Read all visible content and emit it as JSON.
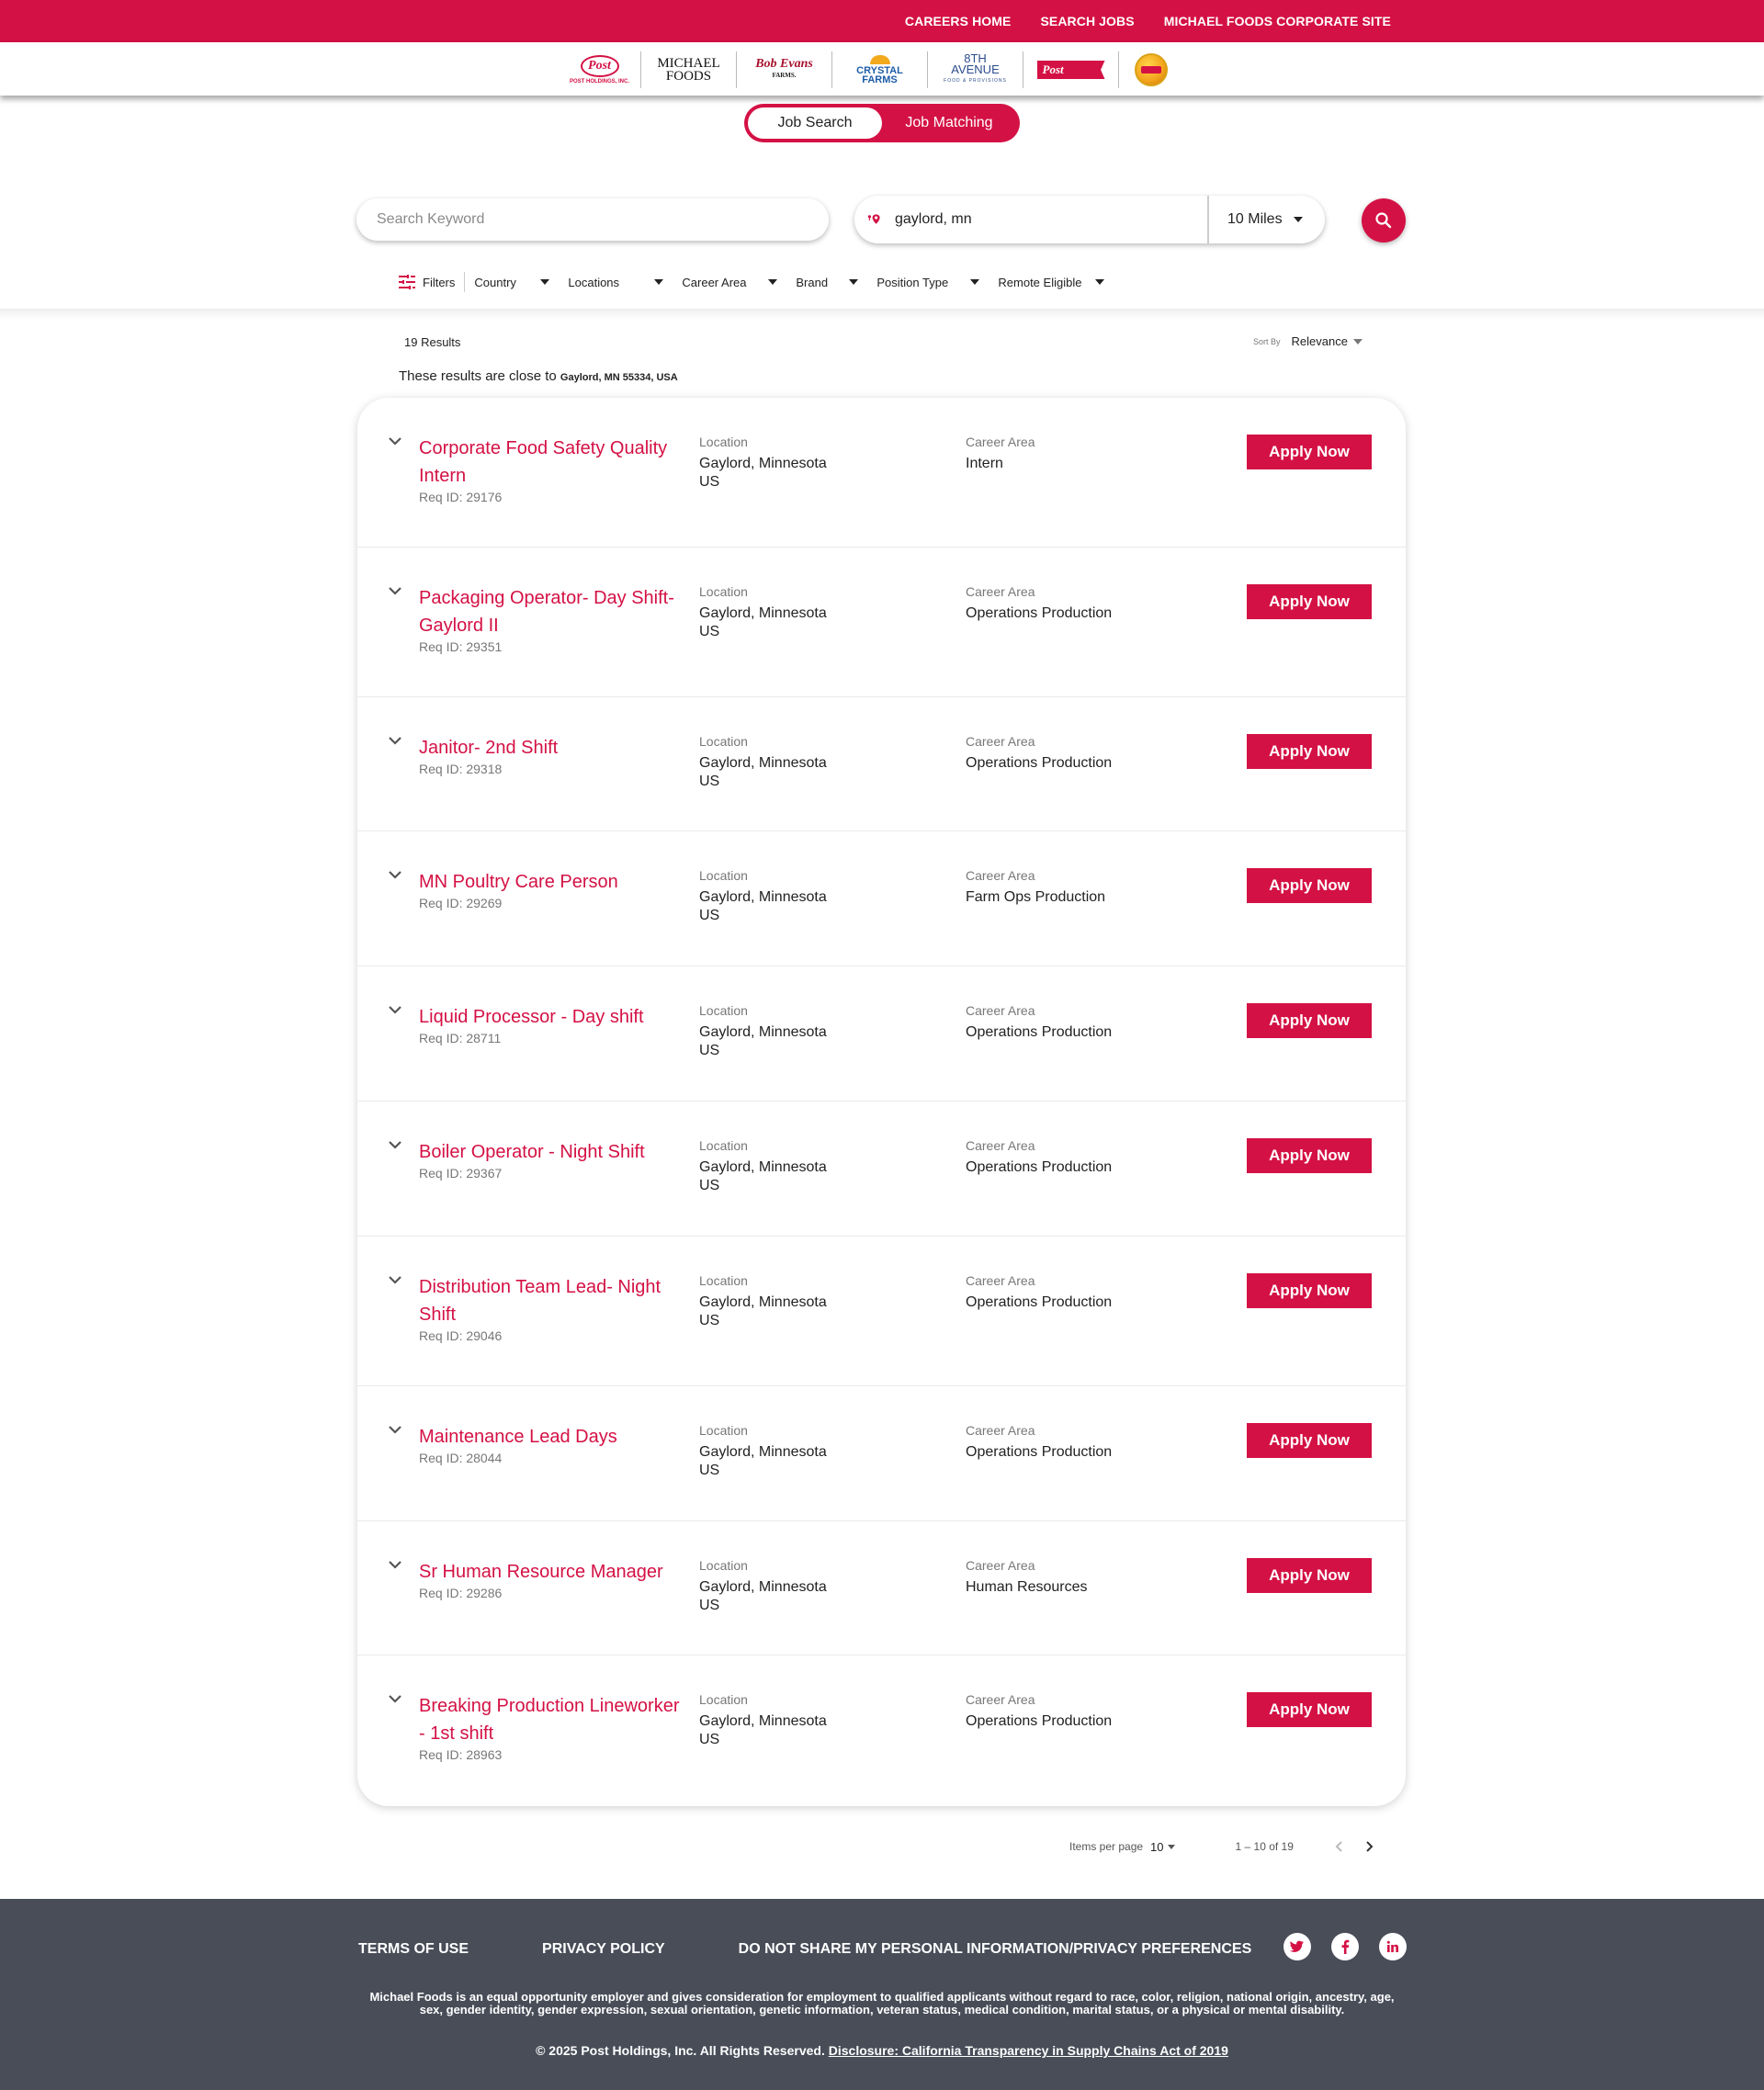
{
  "topnav": {
    "links": [
      "CAREERS HOME",
      "SEARCH JOBS",
      "MICHAEL FOODS CORPORATE SITE"
    ]
  },
  "brands": {
    "post": {
      "mark": "Post",
      "sub": "POST HOLDINGS, INC."
    },
    "michael_foods": {
      "line1": "MICHAEL",
      "line2": "FOODS"
    },
    "bob_evans": {
      "line1": "Bob Evans",
      "line2": "FARMS."
    },
    "crystal_farms": {
      "line1": "CRYSTAL FARMS"
    },
    "eighth_avenue": {
      "line1": "8TH AVENUE",
      "line2": "FOOD & PROVISIONS"
    },
    "post_consumer": {
      "mark": "Post"
    }
  },
  "toggle": {
    "job_search": "Job Search",
    "job_matching": "Job Matching"
  },
  "search": {
    "keyword_placeholder": "Search Keyword",
    "location_value": "gaylord, mn",
    "radius": "10 Miles"
  },
  "filters": {
    "label": "Filters",
    "dropdowns": [
      "Country",
      "Locations",
      "Career Area",
      "Brand",
      "Position Type",
      "Remote Eligible"
    ]
  },
  "results": {
    "count": "19 Results",
    "sort_label": "Sort By",
    "sort_value": "Relevance",
    "close_to_prefix": "These results are close to",
    "close_to_place": "Gaylord, MN 55334, USA"
  },
  "labels": {
    "location": "Location",
    "career_area": "Career Area",
    "apply": "Apply Now"
  },
  "jobs": [
    {
      "title": "Corporate Food Safety Quality Intern",
      "req": "Req ID: 29176",
      "city": "Gaylord, Minnesota",
      "country": "US",
      "area": "Intern"
    },
    {
      "title": "Packaging Operator- Day Shift- Gaylord II",
      "req": "Req ID: 29351",
      "city": "Gaylord, Minnesota",
      "country": "US",
      "area": "Operations Production"
    },
    {
      "title": "Janitor- 2nd Shift",
      "req": "Req ID: 29318",
      "city": "Gaylord, Minnesota",
      "country": "US",
      "area": "Operations Production"
    },
    {
      "title": "MN Poultry Care Person",
      "req": "Req ID: 29269",
      "city": "Gaylord, Minnesota",
      "country": "US",
      "area": "Farm Ops Production"
    },
    {
      "title": "Liquid Processor - Day shift",
      "req": "Req ID: 28711",
      "city": "Gaylord, Minnesota",
      "country": "US",
      "area": "Operations Production"
    },
    {
      "title": "Boiler Operator - Night Shift",
      "req": "Req ID: 29367",
      "city": "Gaylord, Minnesota",
      "country": "US",
      "area": "Operations Production"
    },
    {
      "title": "Distribution Team Lead- Night Shift",
      "req": "Req ID: 29046",
      "city": "Gaylord, Minnesota",
      "country": "US",
      "area": "Operations Production"
    },
    {
      "title": "Maintenance Lead Days",
      "req": "Req ID: 28044",
      "city": "Gaylord, Minnesota",
      "country": "US",
      "area": "Operations Production"
    },
    {
      "title": "Sr Human Resource Manager",
      "req": "Req ID: 29286",
      "city": "Gaylord, Minnesota",
      "country": "US",
      "area": "Human Resources"
    },
    {
      "title": "Breaking Production Lineworker - 1st shift",
      "req": "Req ID: 28963",
      "city": "Gaylord, Minnesota",
      "country": "US",
      "area": "Operations Production"
    }
  ],
  "pager": {
    "items_per_page_label": "Items per page",
    "items_per_page": "10",
    "range": "1 – 10 of 19"
  },
  "footer": {
    "links": [
      "TERMS OF USE",
      "PRIVACY POLICY",
      "DO NOT SHARE MY PERSONAL INFORMATION/PRIVACY PREFERENCES"
    ],
    "social": [
      "twitter-icon",
      "facebook-icon",
      "linkedin-icon"
    ],
    "eeo": "Michael Foods is an equal opportunity employer and gives consideration for employment to qualified applicants without regard to race, color, religion, national origin, ancestry, age, sex, gender identity, gender expression, sexual orientation, genetic information, veteran status, medical condition, marital status, or a physical or mental disability.",
    "copyright": "© 2025 Post Holdings, Inc. All Rights Reserved.",
    "disclosure": "Disclosure: California Transparency in Supply Chains Act of 2019"
  },
  "colors": {
    "brand_red": "#d41144",
    "footer_bg": "#484d58",
    "muted_text": "#777777"
  }
}
